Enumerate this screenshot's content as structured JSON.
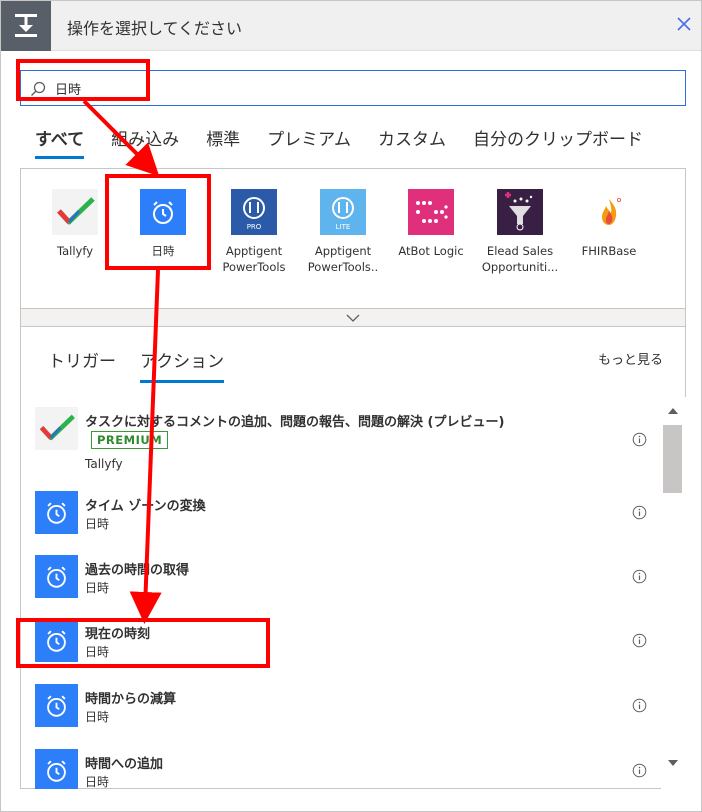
{
  "header": {
    "title": "操作を選択してください"
  },
  "search": {
    "value": "日時"
  },
  "tabs": [
    {
      "label": "すべて",
      "active": true
    },
    {
      "label": "組み込み"
    },
    {
      "label": "標準"
    },
    {
      "label": "プレミアム"
    },
    {
      "label": "カスタム"
    },
    {
      "label": "自分のクリップボード"
    }
  ],
  "connectors": [
    {
      "name": "Tallyfy",
      "icon": "tallyfy-check-icon"
    },
    {
      "name": "日時",
      "icon": "alarm-clock-icon",
      "color": "#2d7ff9"
    },
    {
      "name": "Apptigent PowerTools",
      "icon": "apptigent-pro-icon",
      "color": "#2a5aa8"
    },
    {
      "name": "Apptigent PowerTools..",
      "icon": "apptigent-lite-icon",
      "color": "#5fb4ee"
    },
    {
      "name": "AtBot Logic",
      "icon": "atbot-logic-icon",
      "color": "#e0307c"
    },
    {
      "name": "Elead Sales Opportuniti...",
      "icon": "elead-funnel-icon",
      "color": "#3a1f45"
    },
    {
      "name": "FHIRBase",
      "icon": "fhirbase-flame-icon"
    }
  ],
  "lower": {
    "tabs": [
      {
        "label": "トリガー"
      },
      {
        "label": "アクション",
        "active": true
      }
    ],
    "see_more": "もっと見る"
  },
  "actions": [
    {
      "title": "タスクに対するコメントの追加、問題の報告、問題の解決 (プレビュー)",
      "badge": "PREMIUM",
      "connector": "Tallyfy",
      "icon": "tallyfy-check-icon"
    },
    {
      "title": "タイム ゾーンの変換",
      "connector": "日時",
      "icon": "alarm-clock-icon"
    },
    {
      "title": "過去の時間の取得",
      "connector": "日時",
      "icon": "alarm-clock-icon"
    },
    {
      "title": "現在の時刻",
      "connector": "日時",
      "icon": "alarm-clock-icon"
    },
    {
      "title": "時間からの減算",
      "connector": "日時",
      "icon": "alarm-clock-icon"
    },
    {
      "title": "時間への追加",
      "connector": "日時",
      "icon": "alarm-clock-icon"
    }
  ],
  "colors": {
    "accent": "#0078d4",
    "clock_tile": "#2d7ff9",
    "annotation": "#ff0000",
    "premium": "#3a9a3a"
  }
}
